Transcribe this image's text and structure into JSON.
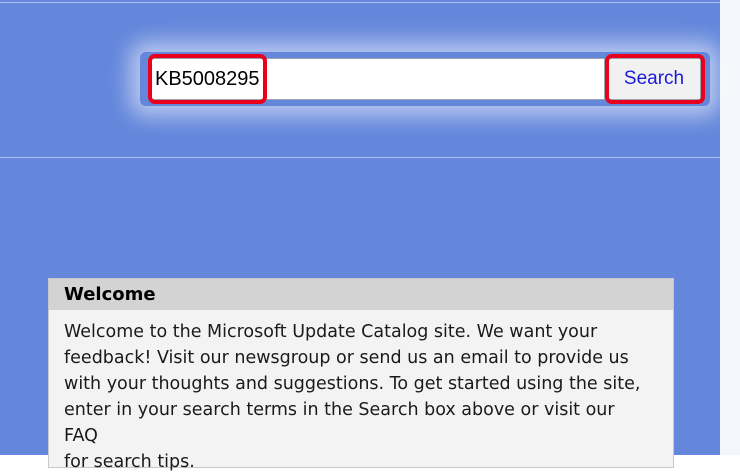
{
  "search": {
    "value": "KB5008295",
    "button_label": "Search"
  },
  "welcome": {
    "title": "Welcome",
    "lines": [
      "Welcome to the Microsoft Update Catalog site. We want your",
      "feedback! Visit our newsgroup or send us an email to provide us",
      "with your thoughts and suggestions. To get started using the site,",
      "enter in your search terms in the Search box above or visit our FAQ",
      "for search tips."
    ]
  },
  "colors": {
    "page_background": "#6487dc",
    "highlight": "#e8001c",
    "button_text": "#1a1adc",
    "panel_header": "#d3d3d3",
    "panel_body": "#f3f3f3"
  }
}
